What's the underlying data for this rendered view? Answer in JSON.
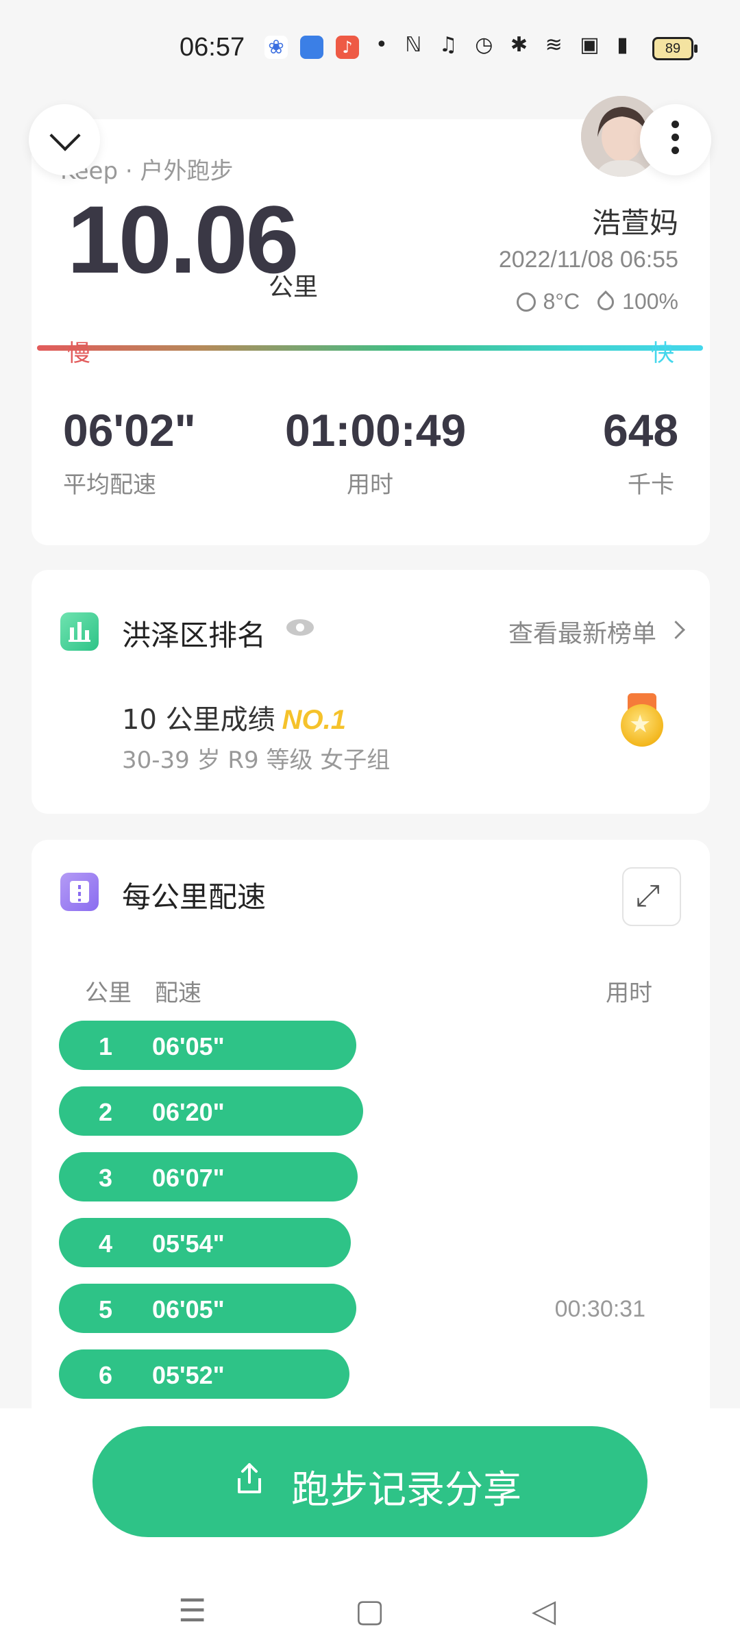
{
  "status_bar": {
    "time": "06:57",
    "icons": [
      "baidu-icon",
      "cloud-app-icon",
      "music-app-icon",
      "dot-icon",
      "nfc-icon",
      "headset-icon",
      "alarm-icon",
      "bluetooth-icon",
      "wifi-icon",
      "hd-icon",
      "signal-4g-icon"
    ],
    "battery": "89"
  },
  "summary": {
    "source": "Keep · 户外跑步",
    "distance": "10.06",
    "distance_unit": "公里",
    "user_name": "浩萱妈",
    "datetime": "2022/11/08 06:55",
    "temperature": "8°C",
    "humidity": "100%",
    "pace_slow_label": "慢",
    "pace_fast_label": "快",
    "stats": [
      {
        "value": "06'02\"",
        "label": "平均配速"
      },
      {
        "value": "01:00:49",
        "label": "用时"
      },
      {
        "value": "648",
        "label": "千卡"
      }
    ]
  },
  "ranking": {
    "title": "洪泽区排名",
    "link": "查看最新榜单",
    "result_label": "10 公里成绩",
    "rank": "NO.1",
    "group": "30-39 岁 R9 等级 女子组"
  },
  "splits": {
    "title": "每公里配速",
    "col_km": "公里",
    "col_pace": "配速",
    "col_time": "用时",
    "rows": [
      {
        "km": "1",
        "pace": "06'05\"",
        "time": ""
      },
      {
        "km": "2",
        "pace": "06'20\"",
        "time": ""
      },
      {
        "km": "3",
        "pace": "06'07\"",
        "time": ""
      },
      {
        "km": "4",
        "pace": "05'54\"",
        "time": ""
      },
      {
        "km": "5",
        "pace": "06'05\"",
        "time": "00:30:31"
      },
      {
        "km": "6",
        "pace": "05'52\"",
        "time": ""
      }
    ]
  },
  "share_button": "跑步记录分享",
  "colors": {
    "accent": "#2ec387",
    "gold": "#f5c22b",
    "slow": "#e25b5b",
    "fast": "#44d7ec"
  }
}
